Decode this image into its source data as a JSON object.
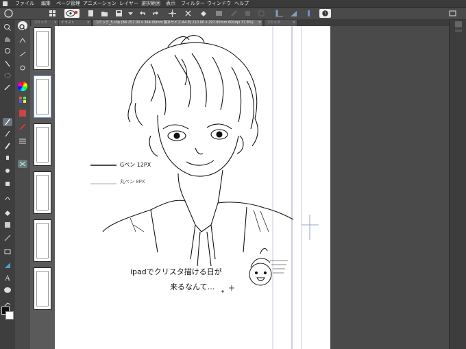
{
  "menu": {
    "items": [
      "ファイル",
      "編集",
      "ページ管理",
      "アニメーション",
      "レイヤー",
      "選択範囲",
      "表示",
      "フィルター",
      "ウィンドウ",
      "ヘルプ"
    ]
  },
  "tabs": {
    "items": [
      {
        "label": "コミック",
        "active": false
      },
      {
        "label": "イラスト",
        "active": false
      },
      {
        "label": "コミック_5.clip (B4 257.00 x 364.00mm 製本サイズ:A4 判 210.00 x 297.00mm 600dpi 37.8%)",
        "active": true
      },
      {
        "label": "コミック",
        "active": false
      }
    ]
  },
  "canvas": {
    "annotations": {
      "pen_a": "Gペン 12PX",
      "pen_b": "丸ペン 8PX",
      "message_line1": "ipadでクリスタ描ける日が",
      "message_line2": "来るなんて…"
    }
  },
  "colors": {
    "ui_dark": "#3a3a3a",
    "ui_mid": "#4a4a4a",
    "paper": "#ffffff",
    "guide_line": "#c8cbe0",
    "frame_line": "#9aa0c8"
  }
}
